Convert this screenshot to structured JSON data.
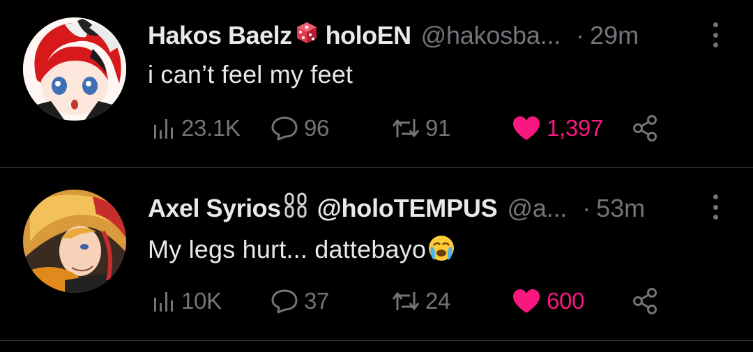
{
  "colors": {
    "background": "#000000",
    "text_primary": "#e7e9ea",
    "text_secondary": "#71767b",
    "like": "#f91880",
    "divider": "#2f3336"
  },
  "tweets": [
    {
      "display_name": "Hakos Baelz",
      "name_suffix": "holoEN",
      "name_emoji_icon": "game-die-icon",
      "handle": "@hakosba...",
      "separator": "·",
      "time": "29m",
      "text": "i can’t feel my feet",
      "views": "23.1K",
      "replies": "96",
      "retweets": "91",
      "likes": "1,397",
      "liked": true
    },
    {
      "display_name": "Axel Syrios",
      "name_emoji_icon": "chain-link-icon",
      "handle": "@holoTEMPUS",
      "handle2": "@a...",
      "separator": "·",
      "time": "53m",
      "text": "My legs hurt... dattebayo",
      "text_emoji_icon": "loudly-crying-face-icon",
      "views": "10K",
      "replies": "37",
      "retweets": "24",
      "likes": "600",
      "liked": true
    }
  ]
}
